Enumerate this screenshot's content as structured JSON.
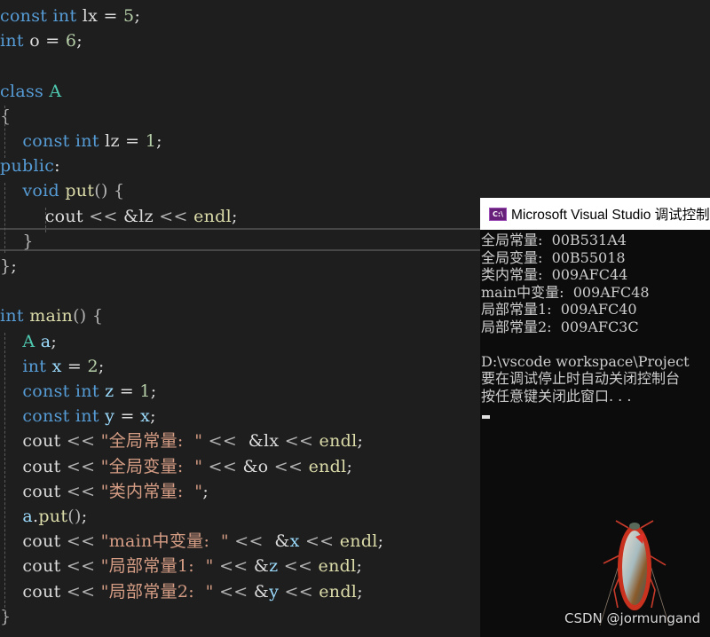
{
  "editor": {
    "lines": [
      {
        "tokens": [
          [
            "kw",
            "const"
          ],
          [
            "plain",
            " "
          ],
          [
            "kw",
            "int"
          ],
          [
            "plain",
            " lx = "
          ],
          [
            "num",
            "5"
          ],
          [
            "plain",
            ";"
          ]
        ]
      },
      {
        "tokens": [
          [
            "kw",
            "int"
          ],
          [
            "plain",
            " o = "
          ],
          [
            "num",
            "6"
          ],
          [
            "plain",
            ";"
          ]
        ]
      },
      {
        "tokens": []
      },
      {
        "tokens": [
          [
            "kw",
            "class"
          ],
          [
            "plain",
            " "
          ],
          [
            "ty",
            "A"
          ]
        ]
      },
      {
        "tokens": [
          [
            "op",
            "{"
          ]
        ]
      },
      {
        "tokens": [
          [
            "plain",
            "    "
          ],
          [
            "kw",
            "const"
          ],
          [
            "plain",
            " "
          ],
          [
            "kw",
            "int"
          ],
          [
            "plain",
            " lz = "
          ],
          [
            "num",
            "1"
          ],
          [
            "plain",
            ";"
          ]
        ]
      },
      {
        "tokens": [
          [
            "kw",
            "public"
          ],
          [
            "plain",
            ":"
          ]
        ]
      },
      {
        "tokens": [
          [
            "plain",
            "    "
          ],
          [
            "kw",
            "void"
          ],
          [
            "plain",
            " "
          ],
          [
            "fn",
            "put"
          ],
          [
            "op",
            "()"
          ],
          [
            "plain",
            " "
          ],
          [
            "op",
            "{"
          ]
        ]
      },
      {
        "tokens": [
          [
            "plain",
            "        cout "
          ],
          [
            "op",
            "<<"
          ],
          [
            "plain",
            " &lz "
          ],
          [
            "op",
            "<<"
          ],
          [
            "plain",
            " "
          ],
          [
            "fn",
            "endl"
          ],
          [
            "plain",
            ";"
          ]
        ]
      },
      {
        "tokens": [
          [
            "plain",
            "    "
          ],
          [
            "op",
            "}"
          ]
        ]
      },
      {
        "tokens": [
          [
            "op",
            "}"
          ],
          [
            "plain",
            ";"
          ]
        ]
      },
      {
        "tokens": []
      },
      {
        "tokens": [
          [
            "kw",
            "int"
          ],
          [
            "plain",
            " "
          ],
          [
            "fn",
            "main"
          ],
          [
            "op",
            "()"
          ],
          [
            "plain",
            " "
          ],
          [
            "op",
            "{"
          ]
        ]
      },
      {
        "tokens": [
          [
            "plain",
            "    "
          ],
          [
            "ty",
            "A"
          ],
          [
            "plain",
            " "
          ],
          [
            "var",
            "a"
          ],
          [
            "plain",
            ";"
          ]
        ]
      },
      {
        "tokens": [
          [
            "plain",
            "    "
          ],
          [
            "kw",
            "int"
          ],
          [
            "plain",
            " "
          ],
          [
            "var",
            "x"
          ],
          [
            "plain",
            " = "
          ],
          [
            "num",
            "2"
          ],
          [
            "plain",
            ";"
          ]
        ]
      },
      {
        "tokens": [
          [
            "plain",
            "    "
          ],
          [
            "kw",
            "const"
          ],
          [
            "plain",
            " "
          ],
          [
            "kw",
            "int"
          ],
          [
            "plain",
            " "
          ],
          [
            "var",
            "z"
          ],
          [
            "plain",
            " = "
          ],
          [
            "num",
            "1"
          ],
          [
            "plain",
            ";"
          ]
        ]
      },
      {
        "tokens": [
          [
            "plain",
            "    "
          ],
          [
            "kw",
            "const"
          ],
          [
            "plain",
            " "
          ],
          [
            "kw",
            "int"
          ],
          [
            "plain",
            " "
          ],
          [
            "var",
            "y"
          ],
          [
            "plain",
            " = "
          ],
          [
            "var",
            "x"
          ],
          [
            "plain",
            ";"
          ]
        ]
      },
      {
        "tokens": [
          [
            "plain",
            "    cout "
          ],
          [
            "op",
            "<<"
          ],
          [
            "plain",
            " "
          ],
          [
            "str",
            "\"全局常量:  \""
          ],
          [
            "plain",
            " "
          ],
          [
            "op",
            "<<"
          ],
          [
            "plain",
            "  &lx "
          ],
          [
            "op",
            "<<"
          ],
          [
            "plain",
            " "
          ],
          [
            "fn",
            "endl"
          ],
          [
            "plain",
            ";"
          ]
        ]
      },
      {
        "tokens": [
          [
            "plain",
            "    cout "
          ],
          [
            "op",
            "<<"
          ],
          [
            "plain",
            " "
          ],
          [
            "str",
            "\"全局变量:  \""
          ],
          [
            "plain",
            " "
          ],
          [
            "op",
            "<<"
          ],
          [
            "plain",
            " &o "
          ],
          [
            "op",
            "<<"
          ],
          [
            "plain",
            " "
          ],
          [
            "fn",
            "endl"
          ],
          [
            "plain",
            ";"
          ]
        ]
      },
      {
        "tokens": [
          [
            "plain",
            "    cout "
          ],
          [
            "op",
            "<<"
          ],
          [
            "plain",
            " "
          ],
          [
            "str",
            "\"类内常量:  \""
          ],
          [
            "plain",
            ";"
          ]
        ]
      },
      {
        "tokens": [
          [
            "plain",
            "    "
          ],
          [
            "var",
            "a"
          ],
          [
            "plain",
            "."
          ],
          [
            "fn",
            "put"
          ],
          [
            "op",
            "()"
          ],
          [
            "plain",
            ";"
          ]
        ]
      },
      {
        "tokens": [
          [
            "plain",
            "    cout "
          ],
          [
            "op",
            "<<"
          ],
          [
            "plain",
            " "
          ],
          [
            "str",
            "\"main中变量:  \""
          ],
          [
            "plain",
            " "
          ],
          [
            "op",
            "<<"
          ],
          [
            "plain",
            "  &"
          ],
          [
            "var",
            "x"
          ],
          [
            "plain",
            " "
          ],
          [
            "op",
            "<<"
          ],
          [
            "plain",
            " "
          ],
          [
            "fn",
            "endl"
          ],
          [
            "plain",
            ";"
          ]
        ]
      },
      {
        "tokens": [
          [
            "plain",
            "    cout "
          ],
          [
            "op",
            "<<"
          ],
          [
            "plain",
            " "
          ],
          [
            "str",
            "\"局部常量1:  \""
          ],
          [
            "plain",
            " "
          ],
          [
            "op",
            "<<"
          ],
          [
            "plain",
            " &"
          ],
          [
            "var",
            "z"
          ],
          [
            "plain",
            " "
          ],
          [
            "op",
            "<<"
          ],
          [
            "plain",
            " "
          ],
          [
            "fn",
            "endl"
          ],
          [
            "plain",
            ";"
          ]
        ]
      },
      {
        "tokens": [
          [
            "plain",
            "    cout "
          ],
          [
            "op",
            "<<"
          ],
          [
            "plain",
            " "
          ],
          [
            "str",
            "\"局部常量2:  \""
          ],
          [
            "plain",
            " "
          ],
          [
            "op",
            "<<"
          ],
          [
            "plain",
            " &"
          ],
          [
            "var",
            "y"
          ],
          [
            "plain",
            " "
          ],
          [
            "op",
            "<<"
          ],
          [
            "plain",
            " "
          ],
          [
            "fn",
            "endl"
          ],
          [
            "plain",
            ";"
          ]
        ]
      },
      {
        "tokens": [
          [
            "op",
            "}"
          ]
        ]
      }
    ]
  },
  "console": {
    "icon_label": "C:\\",
    "title": "Microsoft Visual Studio 调试控制台",
    "output": [
      "全局常量:  00B531A4",
      "全局变量:  00B55018",
      "类内常量:  009AFC44",
      "main中变量:  009AFC48",
      "局部常量1:  009AFC40",
      "局部常量2:  009AFC3C",
      "",
      "D:\\vscode workspace\\Project",
      "要在调试停止时自动关闭控制台",
      "按任意键关闭此窗口. . ."
    ]
  },
  "watermark": {
    "text": "CSDN @jormungand"
  },
  "colors": {
    "editor_bg": "#1e1e1e",
    "console_bg": "#0c0c0c",
    "keyword": "#569cd6",
    "type": "#4ec9b0",
    "function": "#dcdcaa",
    "number": "#b5cea8",
    "string": "#d69d85",
    "variable": "#9cdcfe"
  }
}
